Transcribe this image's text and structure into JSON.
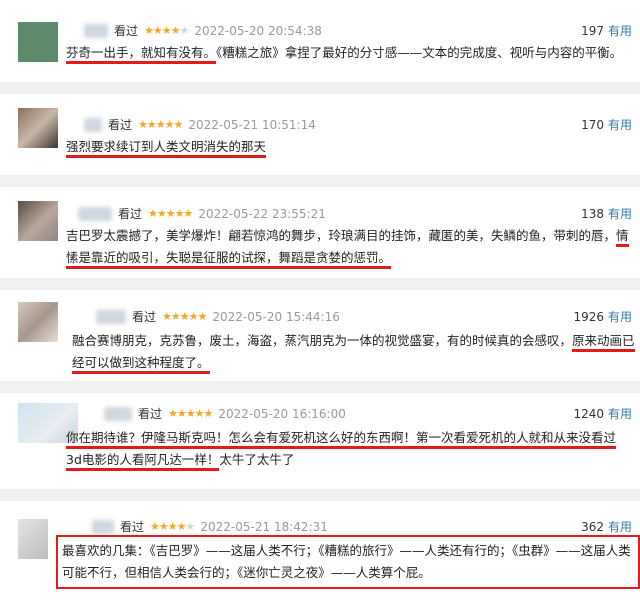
{
  "reviews": [
    {
      "action": "看过",
      "stars": 4,
      "time": "2022-05-20 20:54:38",
      "votes": "197",
      "useful": "有用",
      "parts": [
        {
          "t": "芬奇一出手，就知有没有。",
          "u": true
        },
        {
          "t": "《糟糕之旅》拿捏了最好的分寸感——文本的完成度、视听与内容的平衡。",
          "u": false
        }
      ]
    },
    {
      "action": "看过",
      "stars": 5,
      "time": "2022-05-21 10:51:14",
      "votes": "170",
      "useful": "有用",
      "parts": [
        {
          "t": "强烈要求续订到人类文明消失的那天",
          "u": true
        }
      ]
    },
    {
      "action": "看过",
      "stars": 5,
      "time": "2022-05-22 23:55:21",
      "votes": "138",
      "useful": "有用",
      "parts": [
        {
          "t": "吉巴罗太震撼了，美学爆炸！翩若惊鸿的舞步，玲琅满目的挂饰，藏匿的美，失鳞的鱼，带刺的唇，",
          "u": false
        },
        {
          "t": "情愫是靠近的吸引，失聪是征服的试探，舞蹈是贪婪的惩罚。",
          "u": true
        }
      ]
    },
    {
      "action": "看过",
      "stars": 5,
      "time": "2022-05-20 15:44:16",
      "votes": "1926",
      "useful": "有用",
      "parts": [
        {
          "t": "融合赛博朋克，克苏鲁，废土，海盗，蒸汽朋克为一体的视觉盛宴，有的时候真的会感叹，",
          "u": false
        },
        {
          "t": "原来动画已经可以做到这种程度了。",
          "u": true
        }
      ]
    },
    {
      "action": "看过",
      "stars": 5,
      "time": "2022-05-20 16:16:00",
      "votes": "1240",
      "useful": "有用",
      "parts": [
        {
          "t": "你在期待谁？伊隆马斯克吗！",
          "u": true
        },
        {
          "t": "怎么会有爱死机这么好的东西啊！第一次看爱死机的人就和从来没看过3d电影的人看阿凡达一样！",
          "u": true
        },
        {
          "t": "太牛了太牛了",
          "u": false
        }
      ]
    },
    {
      "action": "看过",
      "stars": 4,
      "time": "2022-05-21 18:42:31",
      "votes": "362",
      "useful": "有用",
      "parts": [
        {
          "t": "最喜欢的几集：《吉巴罗》——这届人类不行；《糟糕的旅行》——人类还有行的；《虫群》——这届人类可能不行，但相信人类会行的；《迷你亡灵之夜》——人类算个屁。",
          "u": false
        }
      ]
    }
  ],
  "colors": {
    "underline": "#e31b1b",
    "star": "#f5a623",
    "useful": "#3377aa"
  }
}
